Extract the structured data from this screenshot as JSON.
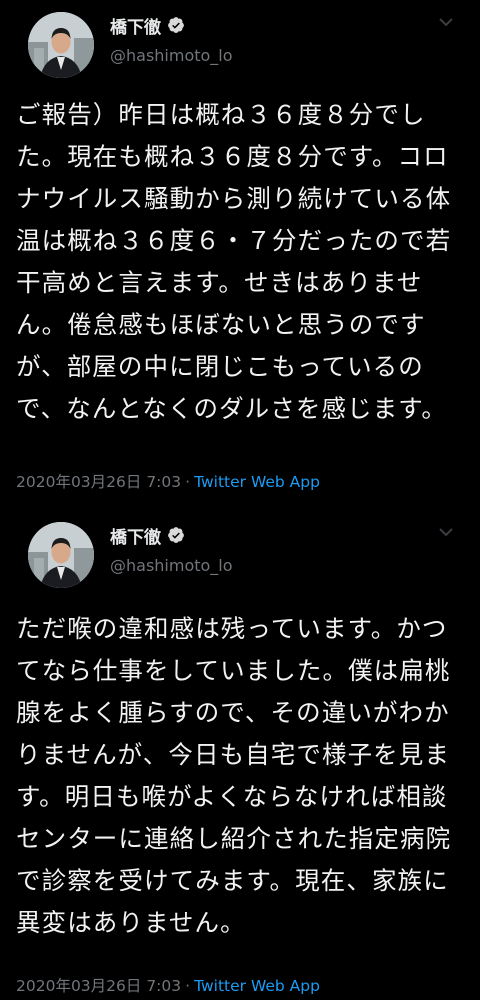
{
  "tweets": [
    {
      "display_name": "橋下徹",
      "handle": "@hashimoto_lo",
      "verified_icon": "verified-badge-icon",
      "menu_icon": "chevron-down-icon",
      "text": "ご報告）昨日は概ね３６度８分でした。現在も概ね３６度８分です。コロナウイルス騒動から測り続けている体温は概ね３６度６・７分だったので若干高めと言えます。せきはありません。倦怠感もほぼないと思うのですが、部屋の中に閉じこもっているので、なんとなくのダルさを感じます。",
      "timestamp": "2020年03月26日 7:03",
      "separator": "·",
      "source": "Twitter Web App"
    },
    {
      "display_name": "橋下徹",
      "handle": "@hashimoto_lo",
      "verified_icon": "verified-badge-icon",
      "menu_icon": "chevron-down-icon",
      "text": "ただ喉の違和感は残っています。かつてなら仕事をしていました。僕は扁桃腺をよく腫らすので、その違いがわかりませんが、今日も自宅で様子を見ます。明日も喉がよくならなければ相談センターに連絡し紹介された指定病院で診察を受けてみます。現在、家族に異変はありません。",
      "timestamp": "2020年03月26日 7:03",
      "separator": "·",
      "source": "Twitter Web App"
    }
  ],
  "colors": {
    "background": "#000000",
    "text": "#f2f2f2",
    "secondary_text": "#71767b",
    "link": "#1d9bf0",
    "verified_badge": "#d9d9d9"
  }
}
